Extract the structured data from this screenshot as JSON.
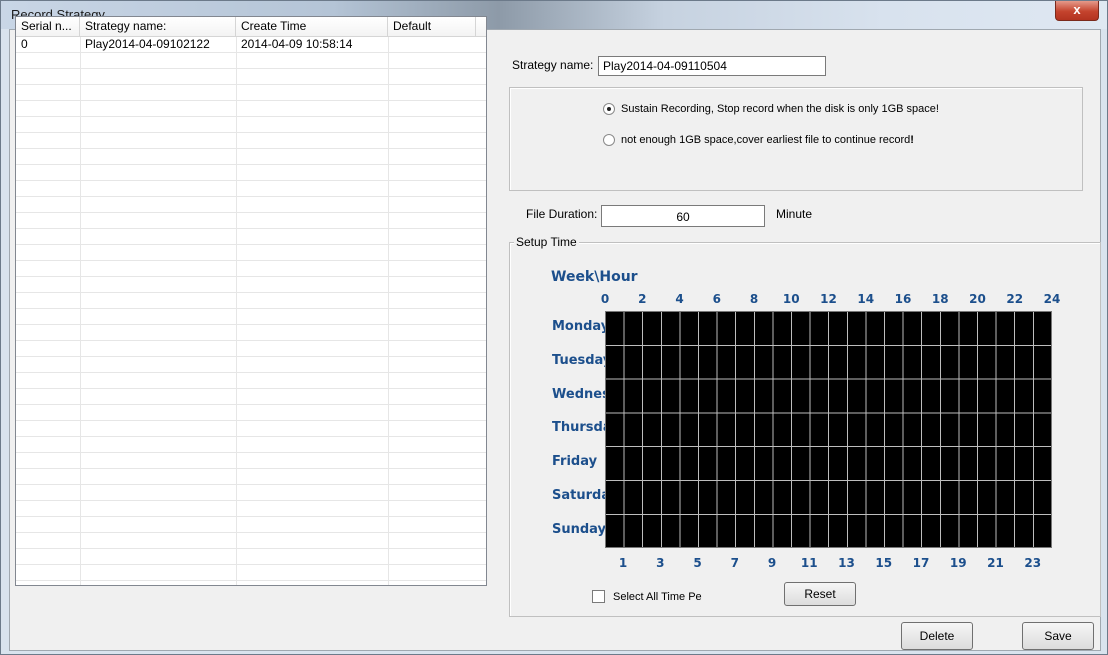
{
  "window": {
    "title": "Record Strategy",
    "close_label": "x"
  },
  "list": {
    "columns": [
      "Serial n...",
      "Strategy name:",
      "Create Time",
      "Default"
    ],
    "rows": [
      {
        "serial": "0",
        "name": "Play2014-04-09102122",
        "time": "2014-04-09 10:58:14",
        "default": ""
      }
    ]
  },
  "form": {
    "strategy_label": "Strategy name:",
    "strategy_value": "Play2014-04-09110504",
    "option1": "Sustain Recording, Stop record when the disk is only 1GB space!",
    "option2": "not enough 1GB space,cover earliest file to continue record",
    "option2_bang": "!",
    "selected_option": 1,
    "duration_label": "File Duration:",
    "duration_value": "60",
    "duration_unit": "Minute",
    "setup_time_label": "Setup Time"
  },
  "schedule": {
    "title": "Week\\Hour",
    "top_hours": [
      "0",
      "2",
      "4",
      "6",
      "8",
      "10",
      "12",
      "14",
      "16",
      "18",
      "20",
      "22",
      "24"
    ],
    "bottom_hours": [
      "1",
      "3",
      "5",
      "7",
      "9",
      "11",
      "13",
      "15",
      "17",
      "19",
      "21",
      "23"
    ],
    "days": [
      "Monday",
      "Tuesday",
      "Wednesday",
      "Thursday",
      "Friday",
      "Saturday",
      "Sunday"
    ],
    "select_all_label": "Select All Time Pe",
    "select_all_checked": false,
    "reset_label": "Reset"
  },
  "buttons": {
    "delete": "Delete",
    "save": "Save"
  },
  "colors": {
    "grid_bg": "#000000",
    "grid_line": "#bdbdbd",
    "label_blue": "#1c4f8c"
  }
}
